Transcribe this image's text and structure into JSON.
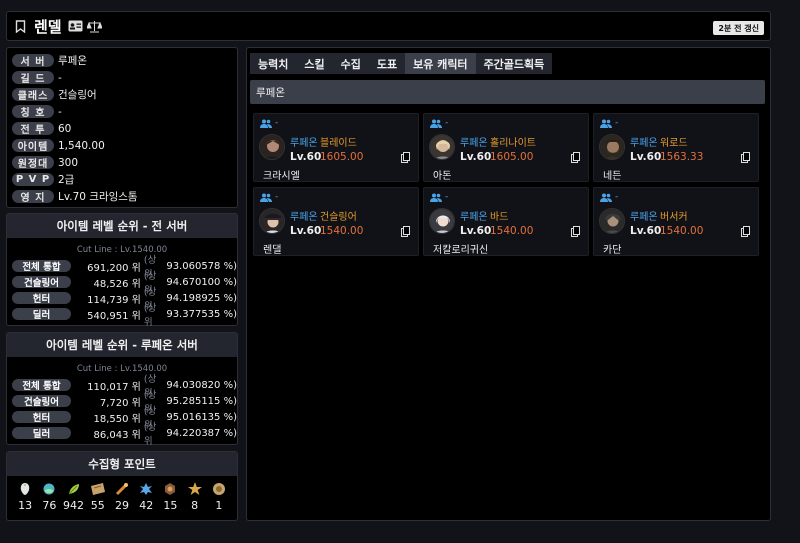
{
  "header": {
    "title": "렌델",
    "update_label": "2분 전 갱신"
  },
  "info": [
    {
      "label": "서 버",
      "value": "루페온"
    },
    {
      "label": "길 드",
      "value": "-"
    },
    {
      "label": "클래스",
      "value": "건슬링어"
    },
    {
      "label": "칭 호",
      "value": "-"
    },
    {
      "label": "전 투",
      "value": "60"
    },
    {
      "label": "아이템",
      "value": "1,540.00"
    },
    {
      "label": "원정대",
      "value": "300"
    },
    {
      "label": "P V P",
      "value": "2급"
    },
    {
      "label": "영 지",
      "value": "Lv.70 크라잉스톰"
    }
  ],
  "rank_all": {
    "title": "아이템 레벨 순위 - 전 서버",
    "cutline": "Cut Line : Lv.1540.00",
    "rows": [
      {
        "label": "전체 통합",
        "rank": "691,200 위",
        "top": "(상위",
        "pct": "93.060578 %)"
      },
      {
        "label": "건슬링어",
        "rank": "48,526 위",
        "top": "(상위",
        "pct": "94.670100 %)"
      },
      {
        "label": "헌터",
        "rank": "114,739 위",
        "top": "(상위",
        "pct": "94.198925 %)"
      },
      {
        "label": "딜러",
        "rank": "540,951 위",
        "top": "(상위",
        "pct": "93.377535 %)"
      }
    ]
  },
  "rank_server": {
    "title": "아이템 레벨 순위 - 루페온 서버",
    "cutline": "Cut Line : Lv.1540.00",
    "rows": [
      {
        "label": "전체 통합",
        "rank": "110,017 위",
        "top": "(상위",
        "pct": "94.030820 %)"
      },
      {
        "label": "건슬링어",
        "rank": "7,720 위",
        "top": "(상위",
        "pct": "95.285115 %)"
      },
      {
        "label": "헌터",
        "rank": "18,550 위",
        "top": "(상위",
        "pct": "95.016135 %)"
      },
      {
        "label": "딜러",
        "rank": "86,043 위",
        "top": "(상위",
        "pct": "94.220387 %)"
      }
    ]
  },
  "collect": {
    "title": "수집형 포인트",
    "items": [
      {
        "icon": "mokoko-seed-icon",
        "value": "13"
      },
      {
        "icon": "island-heart-icon",
        "value": "76"
      },
      {
        "icon": "world-tree-leaf-icon",
        "value": "942"
      },
      {
        "icon": "ignea-token-icon",
        "value": "55"
      },
      {
        "icon": "orpheus-star-icon",
        "value": "29"
      },
      {
        "icon": "giants-heart-icon",
        "value": "42"
      },
      {
        "icon": "masterpiece-icon",
        "value": "15"
      },
      {
        "icon": "sea-bounty-icon",
        "value": "8"
      },
      {
        "icon": "omnium-star-icon",
        "value": "1"
      }
    ]
  },
  "tabs": [
    "능력치",
    "스킬",
    "수집",
    "도표",
    "보유 캐릭터",
    "주간골드획득"
  ],
  "active_tab": "보유 캐릭터",
  "server_bar": "루페온",
  "characters": [
    {
      "guild": "-",
      "server": "루페온",
      "class": "블레이드",
      "level": "Lv.60",
      "ilvl": "1605.00",
      "name": "크라시엘"
    },
    {
      "guild": "-",
      "server": "루페온",
      "class": "홀리나이트",
      "level": "Lv.60",
      "ilvl": "1605.00",
      "name": "아돈"
    },
    {
      "guild": "-",
      "server": "루페온",
      "class": "워로드",
      "level": "Lv.60",
      "ilvl": "1563.33",
      "name": "네든"
    },
    {
      "guild": "-",
      "server": "루페온",
      "class": "건슬링어",
      "level": "Lv.60",
      "ilvl": "1540.00",
      "name": "렌댈"
    },
    {
      "guild": "-",
      "server": "루페온",
      "class": "바드",
      "level": "Lv.60",
      "ilvl": "1540.00",
      "name": "저칼로리귀신"
    },
    {
      "guild": "-",
      "server": "루페온",
      "class": "버서커",
      "level": "Lv.60",
      "ilvl": "1540.00",
      "name": "카단"
    }
  ]
}
